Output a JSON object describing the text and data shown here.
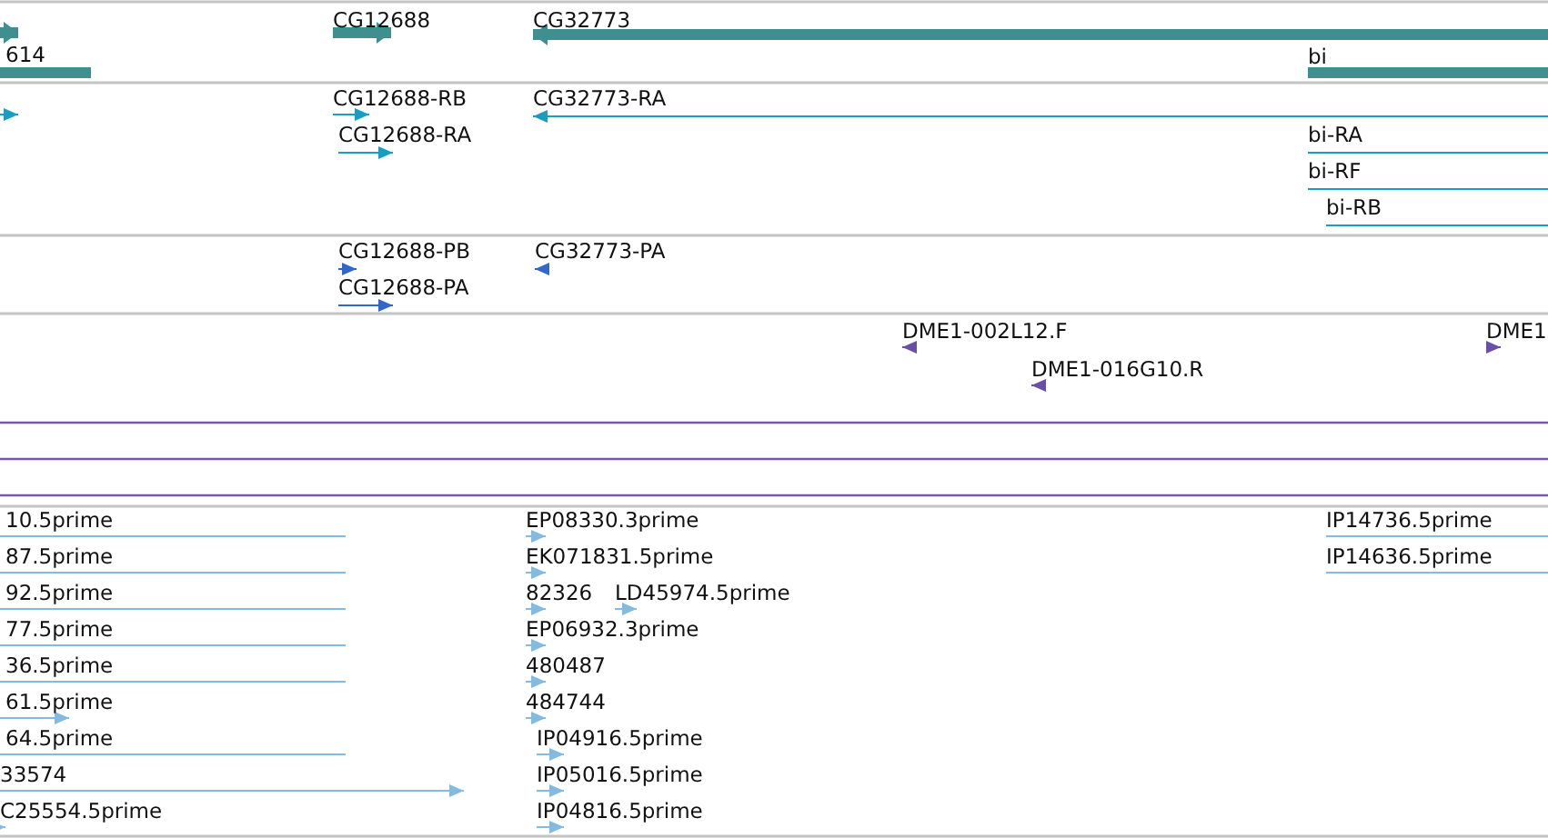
{
  "tracks": [
    {
      "kind": "gene",
      "features": [
        {
          "reverse": false
        },
        {
          "label": "614",
          "reverse": true
        },
        {
          "label": "CG12688",
          "reverse": false
        },
        {
          "label": "CG32773",
          "reverse": true
        },
        {
          "label": "bi",
          "reverse": false
        }
      ]
    },
    {
      "kind": "transcript",
      "features": [
        {
          "reverse": false
        },
        {
          "label": "CG12688-RB",
          "reverse": false
        },
        {
          "label": "CG12688-RA",
          "reverse": false
        },
        {
          "label": "CG32773-RA",
          "reverse": true
        },
        {
          "label": "bi-RA",
          "reverse": false
        },
        {
          "label": "bi-RF",
          "reverse": false
        },
        {
          "label": "bi-RB",
          "reverse": false
        }
      ]
    },
    {
      "kind": "protein",
      "features": [
        {
          "label": "CG12688-PB",
          "reverse": false
        },
        {
          "label": "CG12688-PA",
          "reverse": false
        },
        {
          "label": "CG32773-PA",
          "reverse": true
        }
      ]
    },
    {
      "kind": "clone",
      "features": [
        {
          "label": "DME1-002L12.F",
          "reverse": true
        },
        {
          "label": "DME1-016G10.R",
          "reverse": true
        },
        {
          "label": "DME1",
          "reverse": false
        }
      ]
    },
    {
      "kind": "est",
      "features": [
        {
          "label": "10.5prime",
          "reverse": true
        },
        {
          "label": "EP08330.3prime",
          "reverse": false
        },
        {
          "label": "IP14736.5prime",
          "reverse": false
        },
        {
          "label": "87.5prime",
          "reverse": true
        },
        {
          "label": "EK071831.5prime",
          "reverse": false
        },
        {
          "label": "IP14636.5prime",
          "reverse": false
        },
        {
          "label": "92.5prime",
          "reverse": true
        },
        {
          "label": "82326",
          "reverse": false
        },
        {
          "label": "LD45974.5prime",
          "reverse": false
        },
        {
          "label": "77.5prime",
          "reverse": true
        },
        {
          "label": "EP06932.3prime",
          "reverse": false
        },
        {
          "label": "36.5prime",
          "reverse": true
        },
        {
          "label": "480487",
          "reverse": false
        },
        {
          "label": "61.5prime",
          "reverse": false
        },
        {
          "label": "484744",
          "reverse": false
        },
        {
          "label": "64.5prime",
          "reverse": true
        },
        {
          "label": "IP04916.5prime",
          "reverse": false
        },
        {
          "label": "33574",
          "reverse": false
        },
        {
          "label": "IP05016.5prime",
          "reverse": false
        },
        {
          "label": "C25554.5prime",
          "reverse": false
        },
        {
          "label": "IP04816.5prime",
          "reverse": false
        }
      ]
    }
  ]
}
